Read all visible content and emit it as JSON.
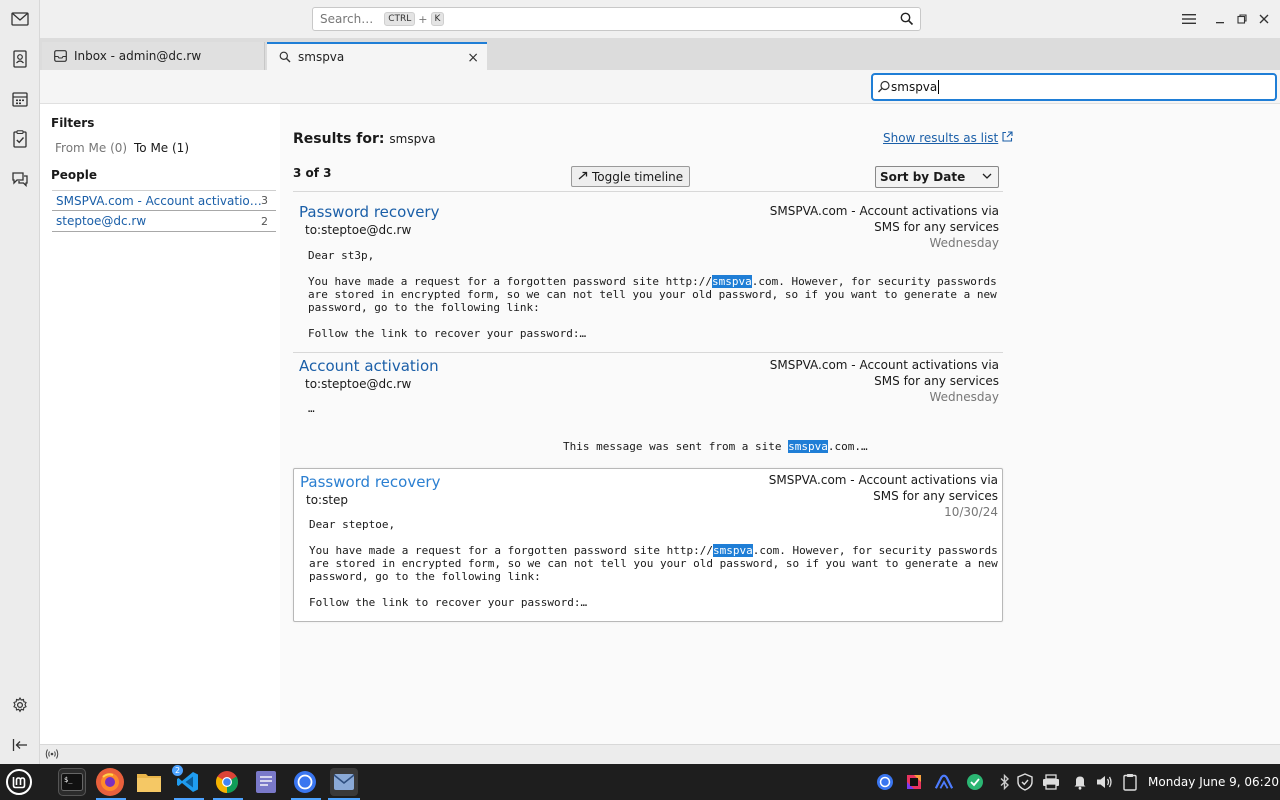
{
  "global_search": {
    "placeholder": "Search…",
    "key1": "CTRL",
    "plus": "+",
    "key2": "K"
  },
  "tabs": [
    {
      "label": "Inbox - admin@dc.rw",
      "icon": "inbox-icon"
    },
    {
      "label": "smspva",
      "icon": "search-icon",
      "close": "×"
    }
  ],
  "toolbar": {
    "search_value": "smspva"
  },
  "filters": {
    "title": "Filters",
    "from_me": "From Me  (0)",
    "to_me": "To Me  (1)",
    "people_title": "People",
    "people": [
      {
        "name": "SMSPVA.com - Account activatio…",
        "count": "3"
      },
      {
        "name": "steptoe@dc.rw",
        "count": "2"
      }
    ]
  },
  "results": {
    "label": "Results for:",
    "query": "smspva",
    "show_as_list": "Show results as list",
    "count": "3 of 3",
    "toggle_timeline": "Toggle timeline",
    "sort": "Sort by Date"
  },
  "messages": [
    {
      "subject": "Password recovery",
      "to": "to:steptoe@dc.rw",
      "sender_line1": "SMSPVA.com - Account activations via",
      "sender_line2": "SMS for any services",
      "date": "Wednesday",
      "greeting": "Dear st3p,",
      "l1_pre": "You have made a request for a forgotten password site http://",
      "l1_hl": "smspva",
      "l1_post": ".com. However, for security passwords",
      "l2": "are stored in encrypted form, so we can not tell you your old password, so if you want to generate a new",
      "l3": "password, go to the following link:",
      "l4": "Follow the link to recover your password:…"
    },
    {
      "subject": "Account activation",
      "to": "to:steptoe@dc.rw",
      "sender_line1": "SMSPVA.com - Account activations via",
      "sender_line2": "SMS for any services",
      "date": "Wednesday",
      "ellipsis": "…",
      "c_pre": "This message was sent from a site ",
      "c_hl": "smspva",
      "c_post": ".com.…"
    },
    {
      "subject": "Password recovery",
      "to": "to:step",
      "sender_line1": "SMSPVA.com - Account activations via",
      "sender_line2": "SMS for any services",
      "date": "10/30/24",
      "greeting": "Dear steptoe,",
      "l1_pre": "You have made a request for a forgotten password site http://",
      "l1_hl": "smspva",
      "l1_post": ".com. However, for security passwords",
      "l2": "are stored in encrypted form, so we can not tell you your old password, so if you want to generate a new",
      "l3": "password, go to the following link:",
      "l4": "Follow the link to recover your password:…"
    }
  ],
  "taskbar": {
    "clock": "Monday June 9, 06:20",
    "vscode_badge": "2"
  },
  "colors": {
    "accent": "#1f7ed6",
    "link": "#1b5fa8",
    "taskbar": "#1e1e1e"
  }
}
